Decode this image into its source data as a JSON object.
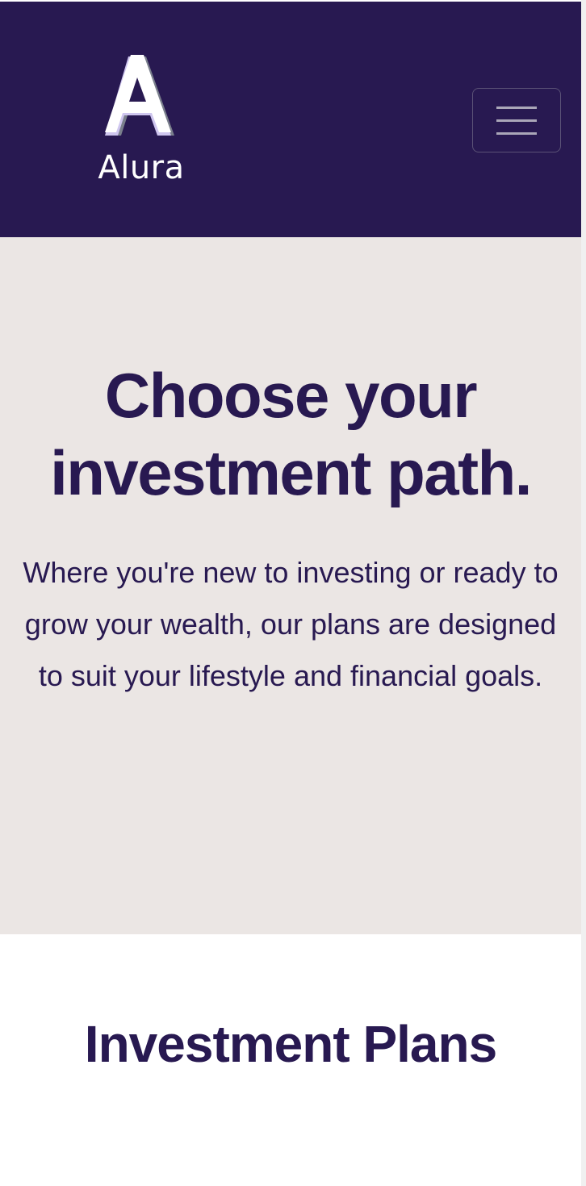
{
  "header": {
    "brand": "Alura",
    "menu_icon": "hamburger-menu-icon",
    "logo_icon": "alura-a-logo-icon"
  },
  "hero": {
    "title": "Choose your investment path.",
    "description": "Where you're new to investing or ready to grow your wealth, our plans are designed to suit your lifestyle and financial goals."
  },
  "plans": {
    "title": "Investment Plans"
  },
  "colors": {
    "brand_navy": "#281951",
    "hero_background": "#ebe6e4",
    "logo_shadow": "#7a7f8c",
    "logo_lavender": "#cfc6ef"
  }
}
